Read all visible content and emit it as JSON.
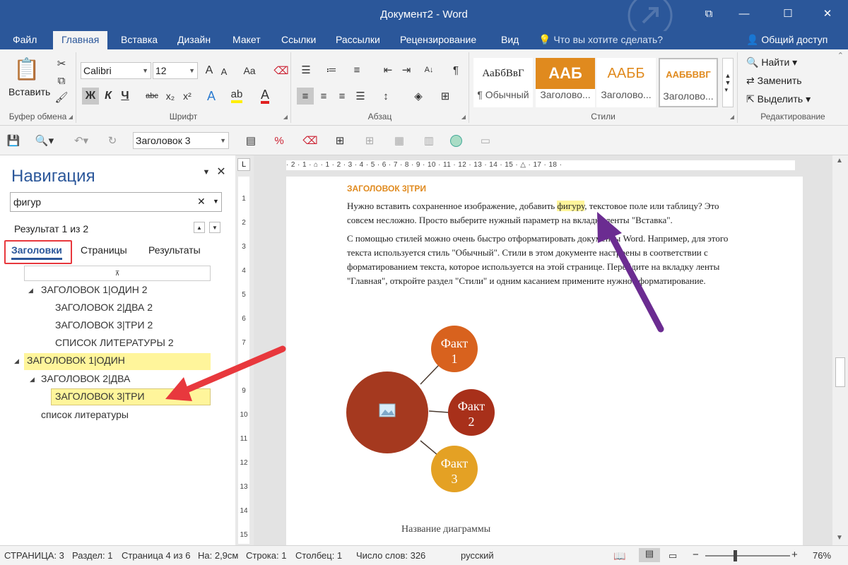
{
  "window": {
    "title": "Документ2 - Word",
    "minimize": "—",
    "maximize": "☐",
    "close": "✕"
  },
  "ribbon_tabs": [
    "Файл",
    "Главная",
    "Вставка",
    "Дизайн",
    "Макет",
    "Ссылки",
    "Рассылки",
    "Рецензирование",
    "Вид"
  ],
  "tell_me": "Что вы хотите сделать?",
  "share": "Общий доступ",
  "clipboard": {
    "paste": "Вставить",
    "label": "Буфер обмена"
  },
  "font": {
    "name": "Calibri",
    "size": "12",
    "label": "Шрифт",
    "bold": "Ж",
    "italic": "К",
    "underline": "Ч",
    "strike": "abc",
    "sub": "x₂",
    "sup": "x²",
    "case": "Aa",
    "grow": "A",
    "shrink": "A"
  },
  "paragraph": {
    "label": "Абзац"
  },
  "styles": {
    "label": "Стили",
    "items": [
      {
        "preview": "АаБбВвГ",
        "name": "¶ Обычный"
      },
      {
        "preview": "ААБ",
        "name": "Заголово..."
      },
      {
        "preview": "ААББ",
        "name": "Заголово..."
      },
      {
        "preview": "ААББВВГ",
        "name": "Заголово..."
      }
    ]
  },
  "editing": {
    "label": "Редактирование",
    "find": "Найти",
    "replace": "Заменить",
    "select": "Выделить"
  },
  "qat": {
    "style_value": "Заголовок 3"
  },
  "nav": {
    "title": "Навигация",
    "search_value": "фигур",
    "result": "Результат 1 из 2",
    "tabs": [
      "Заголовки",
      "Страницы",
      "Результаты"
    ],
    "tree": [
      {
        "text": "ЗАГОЛОВОК 1|ОДИН 2"
      },
      {
        "text": "ЗАГОЛОВОК 2|ДВА 2"
      },
      {
        "text": "ЗАГОЛОВОК 3|ТРИ 2"
      },
      {
        "text": "СПИСОК ЛИТЕРАТУРЫ 2"
      },
      {
        "text": "ЗАГОЛОВОК 1|ОДИН"
      },
      {
        "text": "ЗАГОЛОВОК 2|ДВА"
      },
      {
        "text": "ЗАГОЛОВОК 3|ТРИ"
      },
      {
        "text": "список литературы"
      }
    ]
  },
  "ruler": {
    "h": "· 2 · 1 · ⌂ · 1 · 2 · 3 · 4 · 5 · 6 · 7 · 8 · 9 · 10 · 11 · 12 · 13 · 14 · 15 · △ · 17 · 18 ·",
    "v": [
      "1",
      "2",
      "3",
      "4",
      "5",
      "6",
      "7",
      "8",
      "9",
      "10",
      "11",
      "12",
      "13",
      "14",
      "15"
    ],
    "corner": "L"
  },
  "document": {
    "heading": "ЗАГОЛОВОК 3|ТРИ",
    "p1_pre": "Нужно вставить сохраненное изображение, добавить ",
    "p1_hl": "фигуру",
    "p1_post": ", текстовое поле или таблицу? Это совсем несложно. Просто выберите нужный параметр на вкладке ленты \"Вставка\".",
    "p2": "С помощью стилей можно очень быстро отформатировать документы Word. Например, для этого текста используется стиль \"Обычный\". Стили в этом документе настроены в соответствии с форматированием текста, которое используется на этой странице. Перейдите на вкладку ленты \"Главная\", откройте раздел \"Стили\" и одним касанием примените нужное форматирование.",
    "diagram": {
      "facts": [
        {
          "line1": "Факт",
          "line2": "1"
        },
        {
          "line1": "Факт",
          "line2": "2"
        },
        {
          "line1": "Факт",
          "line2": "3"
        }
      ],
      "title": "Название диаграммы"
    }
  },
  "status": {
    "page": "СТРАНИЦА: 3",
    "section": "Раздел: 1",
    "pages": "Страница 4 из 6",
    "at": "На: 2,9см",
    "line": "Строка: 1",
    "column": "Столбец: 1",
    "words": "Число слов: 326",
    "language": "русский",
    "zoom_out": "−",
    "zoom_in": "+",
    "zoom": "76%"
  },
  "colors": {
    "accent": "#2b579a",
    "heading": "#e08a1e",
    "highlight": "#fff59b",
    "purple_arrow": "#6b2c91",
    "red_arrow": "#e8383d"
  }
}
